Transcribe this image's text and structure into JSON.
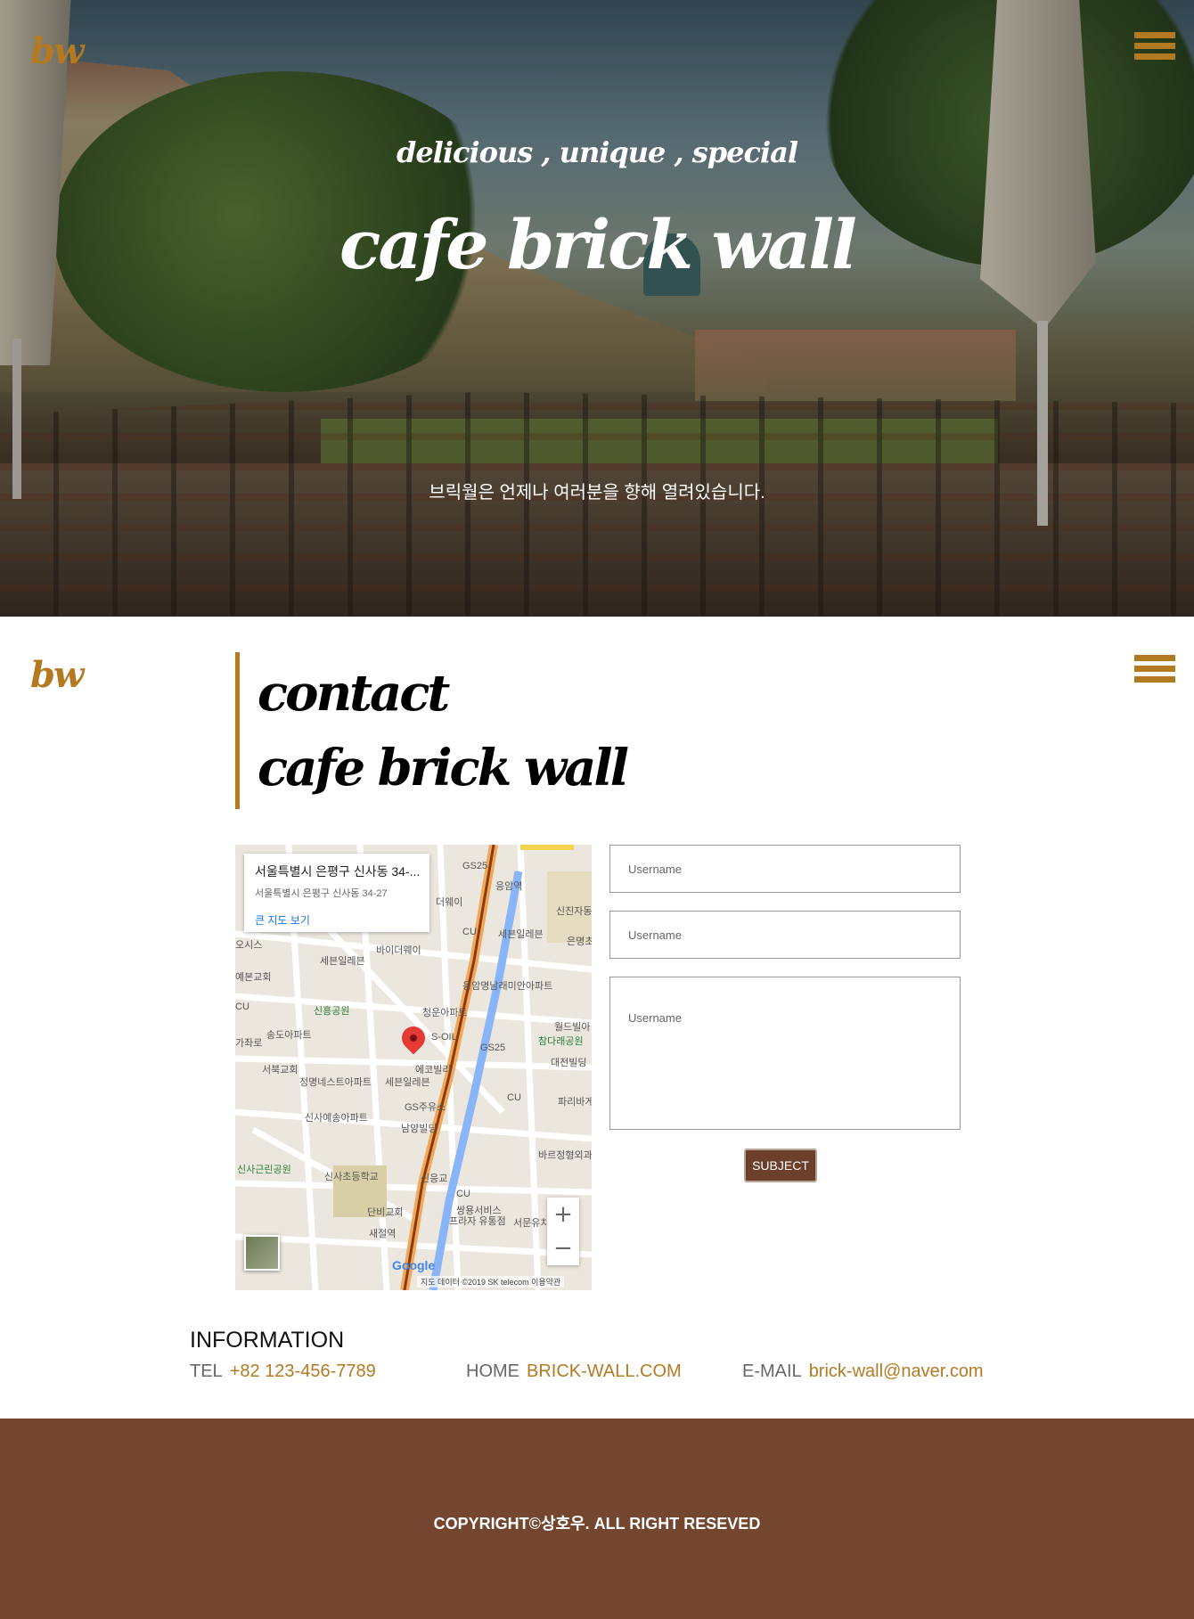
{
  "colors": {
    "accent": "#b47a22",
    "footer_bg": "#74462f",
    "button_bg": "#6b3f29"
  },
  "header": {
    "logo": "bw",
    "menu_icon": "hamburger-icon"
  },
  "hero": {
    "tagline": "delicious , unique , special",
    "title": "cafe brick wall",
    "note": "브릭월은 언제나 여러분을 향해 열려있습니다."
  },
  "contact": {
    "logo": "bw",
    "menu_icon": "hamburger-icon",
    "heading_line1": "contact",
    "heading_line2": "cafe brick wall"
  },
  "map": {
    "info_title": "서울특별시 은평구 신사동 34-...",
    "info_address": "서울특별시 은평구 신사동 34-27",
    "info_link": "큰 지도 보기",
    "zoom_in": "+",
    "zoom_out": "−",
    "google": "Google",
    "attribution": "지도 데이터 ©2019 SK telecom    이용약관",
    "labels": [
      "GS25",
      "응암역",
      "더웨이",
      "신진자동",
      "CU",
      "세븐일레븐",
      "오시스",
      "바이더웨이",
      "세븐일레븐",
      "은명초",
      "예본교회",
      "응암명남래미안아파트",
      "CU",
      "신흥공원",
      "청운아파트",
      "월드빌아",
      "송도아파트",
      "S-OIL",
      "참다래공원",
      "가좌로",
      "GS25",
      "대전빌딩",
      "서북교회",
      "에코빌리",
      "정명네스트아파트",
      "세븐일레븐",
      "CU",
      "파리바게",
      "GS주유소",
      "신사예송아파트",
      "남양빌딩",
      "바르정형외과",
      "신사근린공원",
      "신사초등학교",
      "신응교",
      "CU",
      "단비교회",
      "쌍용서비스",
      "프라자 유통점",
      "서문유치원",
      "새절역"
    ]
  },
  "form": {
    "field1_placeholder": "Username",
    "field2_placeholder": "Username",
    "field3_placeholder": "Username",
    "submit_label": "SUBJECT"
  },
  "information": {
    "title": "INFORMATION",
    "tel_label": "TEL",
    "tel_value": "+82 123-456-7789",
    "home_label": "HOME",
    "home_value": "BRICK-WALL.COM",
    "email_label": "E-MAIL",
    "email_value": "brick-wall@naver.com"
  },
  "footer": {
    "copyright": "COPYRIGHT©상호우. ALL RIGHT RESEVED"
  }
}
